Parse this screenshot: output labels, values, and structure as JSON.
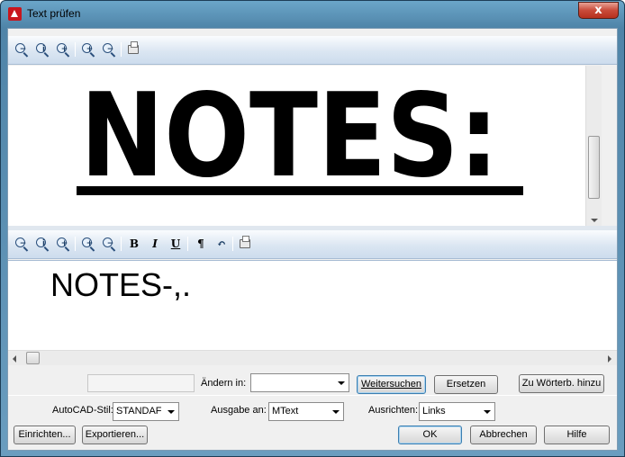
{
  "window": {
    "title": "Text prüfen",
    "close": "x"
  },
  "toolbar_top": {
    "icons": [
      "zoom-out-icon",
      "zoom-extents-icon",
      "zoom-window-icon",
      "zoom-in-icon",
      "zoom-out-small-icon",
      "print-preview-icon"
    ]
  },
  "preview": {
    "image_text": "NOTES:"
  },
  "toolbar_bottom": {
    "bold": "B",
    "italic": "I",
    "underline": "U",
    "paragraph": "¶",
    "undo": "↶"
  },
  "editor": {
    "text": "NOTES-,."
  },
  "find": {
    "change_label": "Ändern in:",
    "change_value": "",
    "find_next": "Weitersuchen",
    "replace": "Ersetzen",
    "add_dictionary": "Zu Wörterb. hinzu"
  },
  "options": {
    "style_label": "AutoCAD-Stil:",
    "style_value": "STANDAF",
    "output_label": "Ausgabe an:",
    "output_value": "MText",
    "align_label": "Ausrichten:",
    "align_value": "Links"
  },
  "buttons": {
    "setup": "Einrichten...",
    "export": "Exportieren...",
    "ok": "OK",
    "cancel": "Abbrechen",
    "help": "Hilfe"
  }
}
